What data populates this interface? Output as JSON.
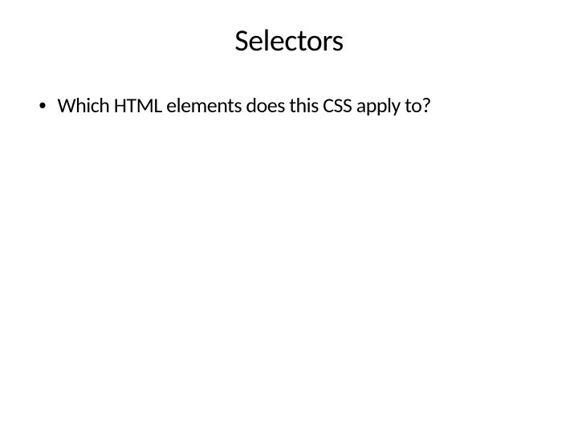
{
  "slide": {
    "title": "Selectors",
    "bullets": [
      {
        "marker": "•",
        "text": "Which HTML elements does this CSS apply to?"
      }
    ]
  }
}
